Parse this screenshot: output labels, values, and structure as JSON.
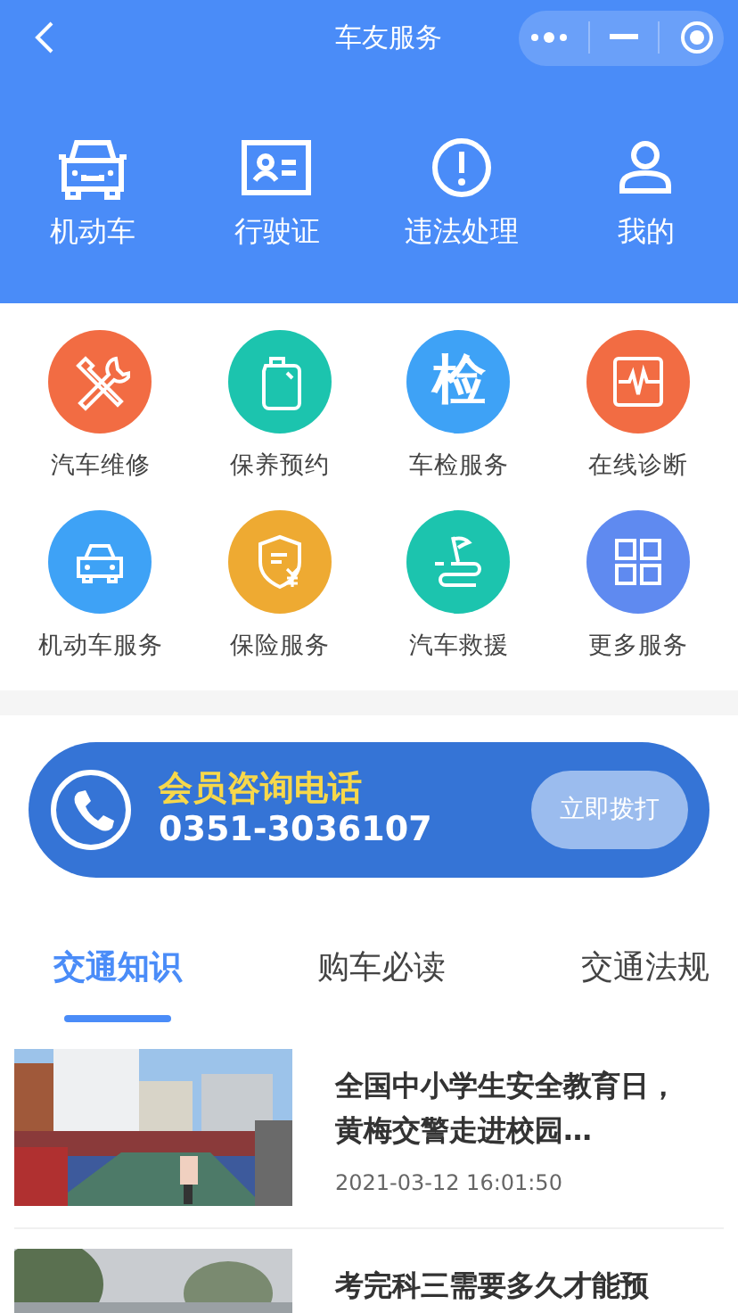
{
  "nav": {
    "title": "车友服务"
  },
  "top_menu": [
    {
      "label": "机动车"
    },
    {
      "label": "行驶证"
    },
    {
      "label": "违法处理"
    },
    {
      "label": "我的"
    }
  ],
  "services": [
    {
      "label": "汽车维修",
      "color": "#f26c43"
    },
    {
      "label": "保养预约",
      "color": "#1cc4ae"
    },
    {
      "label": "车检服务",
      "color": "#3ea2f6",
      "glyph": "检"
    },
    {
      "label": "在线诊断",
      "color": "#f26c43"
    },
    {
      "label": "机动车服务",
      "color": "#3ea2f6"
    },
    {
      "label": "保险服务",
      "color": "#eeaa32"
    },
    {
      "label": "汽车救援",
      "color": "#1cc4ae"
    },
    {
      "label": "更多服务",
      "color": "#5f8af0"
    }
  ],
  "hotline": {
    "title": "会员咨询电话",
    "number": "0351-3036107",
    "button": "立即拨打"
  },
  "tabs": [
    {
      "label": "交通知识",
      "selected": true
    },
    {
      "label": "购车必读",
      "selected": false
    },
    {
      "label": "交通法规",
      "selected": false
    }
  ],
  "articles": [
    {
      "title": "全国中小学生安全教育日，黄梅交警走进校园…",
      "date": "2021-03-12 16:01:50"
    },
    {
      "title": "考完科三需要多久才能预"
    }
  ]
}
